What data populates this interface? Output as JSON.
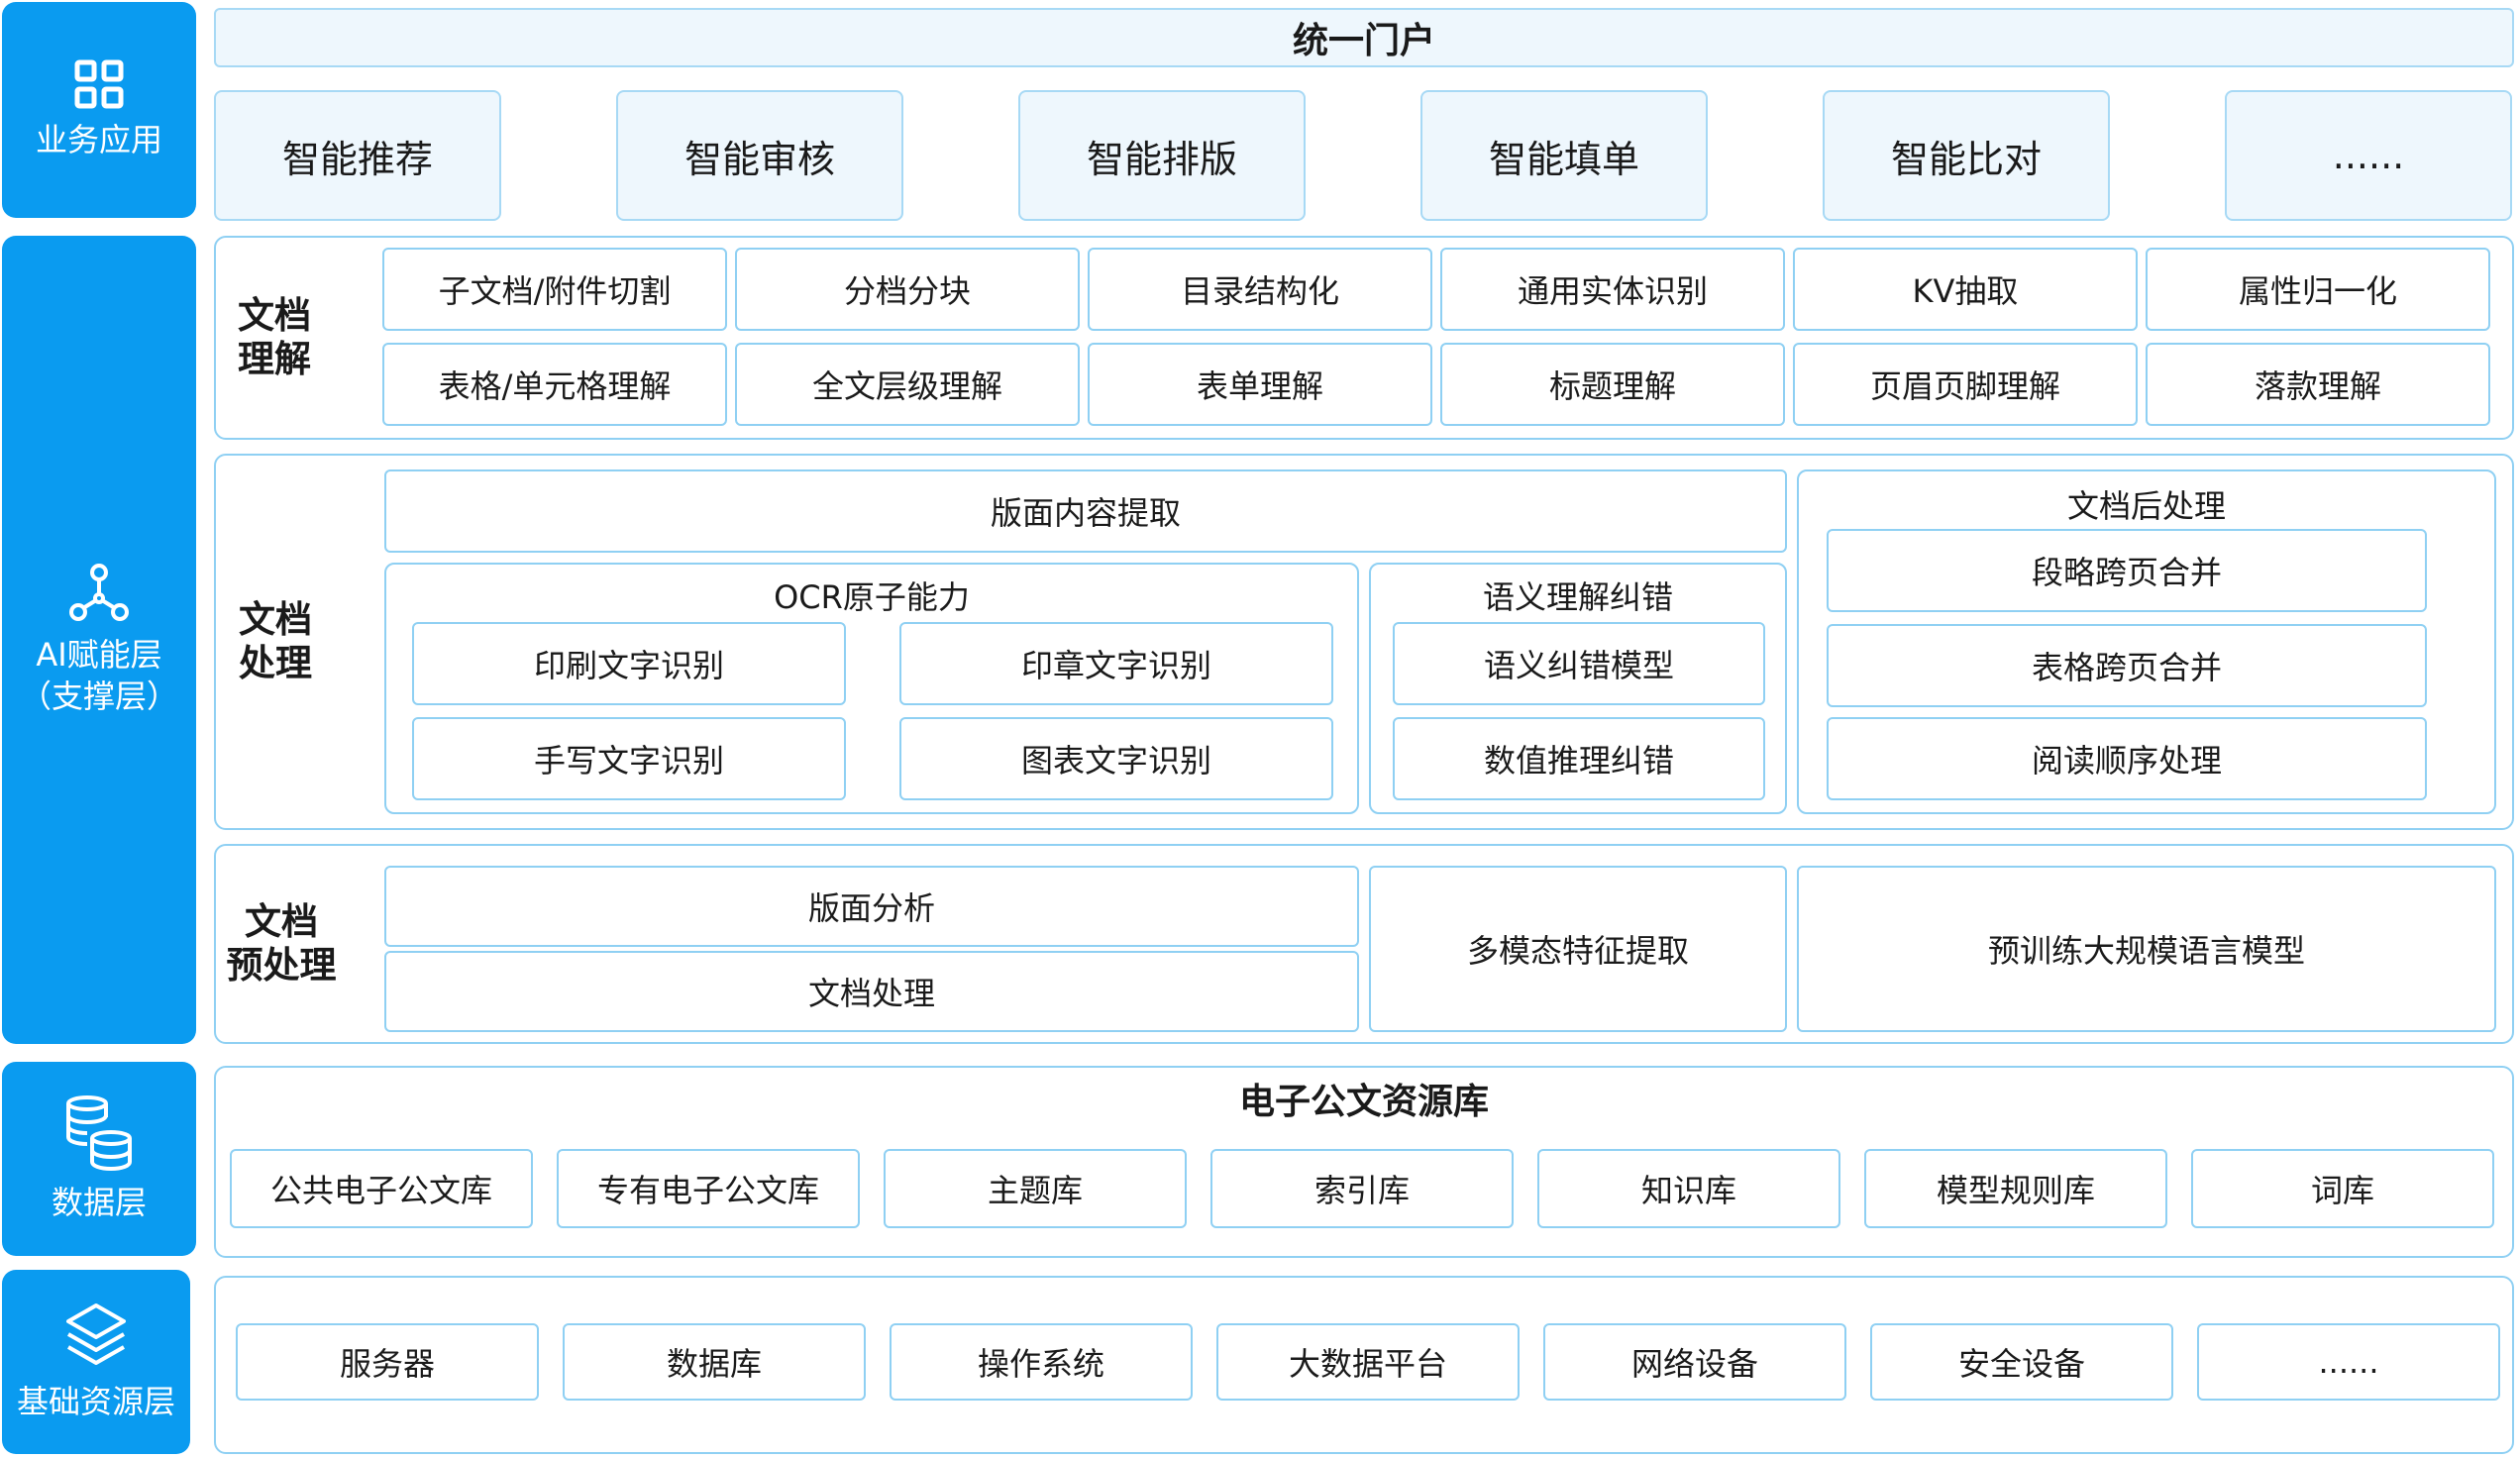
{
  "layers": {
    "business": "业务应用",
    "ai": "AI赋能层\n（支撑层）",
    "data": "数据层",
    "infra": "基础资源层"
  },
  "portal": {
    "title": "统一门户",
    "apps": [
      "智能推荐",
      "智能审核",
      "智能排版",
      "智能填单",
      "智能比对",
      "......"
    ]
  },
  "understanding": {
    "label": "文档\n理解",
    "row1": [
      "子文档/附件切割",
      "分档分块",
      "目录结构化",
      "通用实体识别",
      "KV抽取",
      "属性归一化"
    ],
    "row2": [
      "表格/单元格理解",
      "全文层级理解",
      "表单理解",
      "标题理解",
      "页眉页脚理解",
      "落款理解"
    ]
  },
  "processing": {
    "label": "文档\n处理",
    "layout_extract": "版面内容提取",
    "ocr": {
      "title": "OCR原子能力",
      "items": [
        "印刷文字识别",
        "印章文字识别",
        "手写文字识别",
        "图表文字识别"
      ]
    },
    "semantic": {
      "title": "语义理解纠错",
      "items": [
        "语义纠错模型",
        "数值推理纠错"
      ]
    },
    "post": {
      "title": "文档后处理",
      "items": [
        "段略跨页合并",
        "表格跨页合并",
        "阅读顺序处理"
      ]
    }
  },
  "preprocessing": {
    "label": "文档\n预处理",
    "layout_analysis": "版面分析",
    "doc_process": "文档处理",
    "multimodal": "多模态特征提取",
    "llm": "预训练大规模语言模型"
  },
  "repository": {
    "title": "电子公文资源库",
    "items": [
      "公共电子公文库",
      "专有电子公文库",
      "主题库",
      "索引库",
      "知识库",
      "模型规则库",
      "词库"
    ]
  },
  "infra": {
    "items": [
      "服务器",
      "数据库",
      "操作系统",
      "大数据平台",
      "网络设备",
      "安全设备",
      "......"
    ]
  },
  "icons": {
    "business": "grid-icon",
    "ai": "network-nodes-icon",
    "data": "database-icon",
    "infra": "layers-icon"
  },
  "colors": {
    "sidebar": "#0a9bf0",
    "border": "#8fd0f3",
    "tint": "#eef7fd"
  }
}
